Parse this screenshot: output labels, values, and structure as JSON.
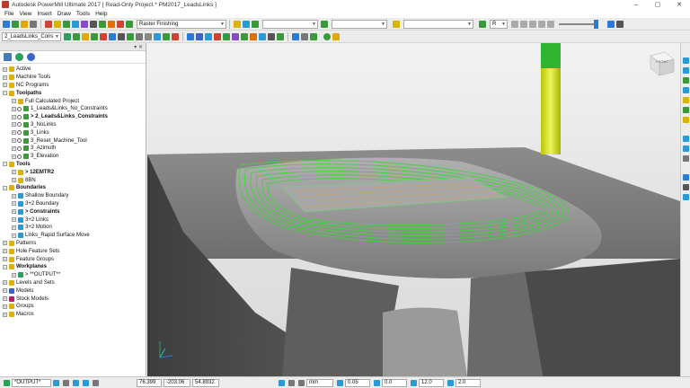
{
  "window": {
    "title": "Autodesk PowerMill Ultimate 2017   [ Read-Only Project * PM2017_LeadsLinks ]",
    "controls": [
      "–",
      "▢",
      "✕"
    ]
  },
  "menu": [
    "File",
    "View",
    "Insert",
    "Draw",
    "Tools",
    "Help"
  ],
  "toolbar": {
    "strategy_combo": "Raster Finishing",
    "workplane_combo": "2_LeadsLinks_Cons",
    "playback_label": "R"
  },
  "explorer": {
    "header_controls": "▾ ✕",
    "tree": [
      {
        "label": "Active",
        "depth": 0,
        "exp": "+",
        "icon": "folder-icon",
        "color": "#e0b000"
      },
      {
        "label": "Machine Tools",
        "depth": 0,
        "exp": "+",
        "icon": "folder-icon",
        "color": "#e0b000"
      },
      {
        "label": "NC Programs",
        "depth": 0,
        "exp": "+",
        "icon": "folder-icon",
        "color": "#e0b000"
      },
      {
        "label": "Toolpaths",
        "depth": 0,
        "exp": "−",
        "icon": "folder-icon",
        "color": "#e0b000",
        "bold": true
      },
      {
        "label": "Full Calculated Project",
        "depth": 1,
        "exp": "+",
        "icon": "folder-icon",
        "color": "#e0b000"
      },
      {
        "label": "1_Leads&Links_No_Constraints",
        "depth": 1,
        "exp": "+",
        "icon": "toolpath-icon",
        "color": "#3a9a3a",
        "check": true
      },
      {
        "label": "> 2_Leads&Links_Constraints",
        "depth": 1,
        "exp": "+",
        "icon": "toolpath-icon",
        "color": "#3a9a3a",
        "check": true,
        "bold": true
      },
      {
        "label": "3_NoLinks",
        "depth": 1,
        "exp": "+",
        "icon": "toolpath-icon",
        "color": "#3a9a3a",
        "check": true
      },
      {
        "label": "3_Links",
        "depth": 1,
        "exp": "+",
        "icon": "toolpath-icon",
        "color": "#3a9a3a",
        "check": true
      },
      {
        "label": "3_Reset_Machine_Tool",
        "depth": 1,
        "exp": "+",
        "icon": "toolpath-icon",
        "color": "#3a9a3a",
        "check": true
      },
      {
        "label": "3_Azimuth",
        "depth": 1,
        "exp": "+",
        "icon": "toolpath-icon",
        "color": "#3a9a3a",
        "check": true
      },
      {
        "label": "3_Elevation",
        "depth": 1,
        "exp": "+",
        "icon": "toolpath-icon",
        "color": "#3a9a3a",
        "check": true
      },
      {
        "label": "Tools",
        "depth": 0,
        "exp": "−",
        "icon": "folder-icon",
        "color": "#e0b000",
        "bold": true
      },
      {
        "label": "> 12EMTR2",
        "depth": 1,
        "exp": "+",
        "icon": "tool-icon",
        "color": "#d9b400",
        "bold": true
      },
      {
        "label": "8BN",
        "depth": 1,
        "exp": "+",
        "icon": "tool-icon",
        "color": "#d9b400"
      },
      {
        "label": "Boundaries",
        "depth": 0,
        "exp": "−",
        "icon": "folder-icon",
        "color": "#e0b000",
        "bold": true
      },
      {
        "label": "Shallow Boundary",
        "depth": 1,
        "exp": "+",
        "icon": "boundary-icon",
        "color": "#2a9ad6"
      },
      {
        "label": "3+2 Boundary",
        "depth": 1,
        "exp": "+",
        "icon": "boundary-icon",
        "color": "#2a9ad6"
      },
      {
        "label": "> Constraints",
        "depth": 1,
        "exp": "+",
        "icon": "boundary-icon",
        "color": "#2a9ad6",
        "bold": true
      },
      {
        "label": "3+2 Links",
        "depth": 1,
        "exp": "+",
        "icon": "boundary-icon",
        "color": "#2a9ad6"
      },
      {
        "label": "3+2 Motion",
        "depth": 1,
        "exp": "+",
        "icon": "boundary-icon",
        "color": "#2a9ad6"
      },
      {
        "label": "Links_Rapid Surface Move",
        "depth": 1,
        "exp": "+",
        "icon": "boundary-icon",
        "color": "#2a9ad6"
      },
      {
        "label": "Patterns",
        "depth": 0,
        "exp": "+",
        "icon": "folder-icon",
        "color": "#e0b000"
      },
      {
        "label": "Hole Feature Sets",
        "depth": 0,
        "exp": "+",
        "icon": "folder-icon",
        "color": "#e0b000"
      },
      {
        "label": "Feature Groups",
        "depth": 0,
        "exp": "+",
        "icon": "folder-icon",
        "color": "#e0b000"
      },
      {
        "label": "Workplanes",
        "depth": 0,
        "exp": "−",
        "icon": "folder-icon",
        "color": "#e0b000",
        "bold": true
      },
      {
        "label": "> **OUTPUT**",
        "depth": 1,
        "exp": "+",
        "icon": "workplane-icon",
        "color": "#2aa05a"
      },
      {
        "label": "Levels and Sets",
        "depth": 0,
        "exp": "+",
        "icon": "folder-icon",
        "color": "#e0b000"
      },
      {
        "label": "Models",
        "depth": 0,
        "exp": "+",
        "icon": "models-icon",
        "color": "#3a64c8"
      },
      {
        "label": "Stock Models",
        "depth": 0,
        "exp": "+",
        "icon": "stock-icon",
        "color": "#b0206a"
      },
      {
        "label": "Groups",
        "depth": 0,
        "exp": "+",
        "icon": "folder-icon",
        "color": "#e0b000"
      },
      {
        "label": "Macros",
        "depth": 0,
        "exp": "+",
        "icon": "folder-icon",
        "color": "#e0b000"
      }
    ]
  },
  "viewport": {
    "viewcube_label": "FRONT"
  },
  "status": {
    "workplane": "*OUTPUT*",
    "x": "76.399",
    "y": "-203.06",
    "z": "54.8932",
    "units": "mm",
    "tolerance": "0.05",
    "thickness": "0.0",
    "diameter": "12.0",
    "step": "2.0"
  }
}
